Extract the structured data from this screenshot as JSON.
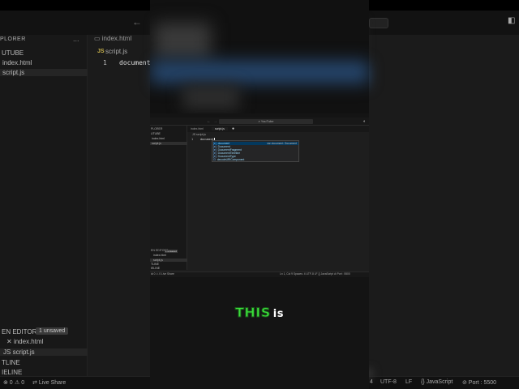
{
  "background_editor": {
    "explorer_title": "PLORER",
    "explorer_dots": "...",
    "folder": "UTUBE",
    "files": [
      "index.html",
      "script.js"
    ],
    "active_file": "script.js",
    "tab_label": "index.html",
    "breadcrumb_lang": "JS",
    "breadcrumb": "script.js",
    "line_number": "1",
    "code": "document",
    "open_editors_label": "EN EDITORS",
    "unsaved_badge": "1 unsaved",
    "open_files": [
      "index.html",
      "script.js"
    ],
    "outline_label": "TLINE",
    "timeline_label": "IELINE",
    "status_left": [
      "⊗ 0",
      "⚠ 0",
      "Live Share"
    ],
    "status_right": [
      "4",
      "UTF-8",
      "LF",
      "{} JavaScript",
      "⊘ Port : 5500"
    ]
  },
  "video_editor": {
    "search_text": "⌕ YouTube",
    "explorer_title": "PLORER",
    "folder": "UTUBE",
    "files": [
      "index.html",
      "script.js"
    ],
    "active_file": "script.js",
    "tabs": [
      "index.html",
      "script.js"
    ],
    "active_tab": "script.js",
    "breadcrumb": "JS script.js",
    "line_number": "1",
    "code": "document",
    "suggestions": [
      {
        "icon": "[e]",
        "label": "document",
        "detail": "var document: Document"
      },
      {
        "icon": "[e]",
        "label": "Document",
        "detail": ""
      },
      {
        "icon": "[e]",
        "label": "DocumentFragment",
        "detail": ""
      },
      {
        "icon": "[e]",
        "label": "DocumentTimeline",
        "detail": ""
      },
      {
        "icon": "[e]",
        "label": "DocumentType",
        "detail": ""
      },
      {
        "icon": "⊡",
        "label": "decodeURIComponent",
        "detail": ""
      }
    ],
    "open_editors_label": "EN EDITORS",
    "unsaved_badge": "1 unsaved",
    "open_files": [
      "index.html",
      "script.js"
    ],
    "outline_label": "TLINE",
    "timeline_label": "IELINE",
    "status_left": "⊗ 0  ⚠ 0   Live Share",
    "status_right": "Ln 1, Col 9   Spaces: 4   UTF-8   LF   {} JavaScript   ⊘ Port : 5500"
  },
  "caption": {
    "highlight": "THIS",
    "rest": "is",
    "highlight_color": "#3be03b"
  }
}
